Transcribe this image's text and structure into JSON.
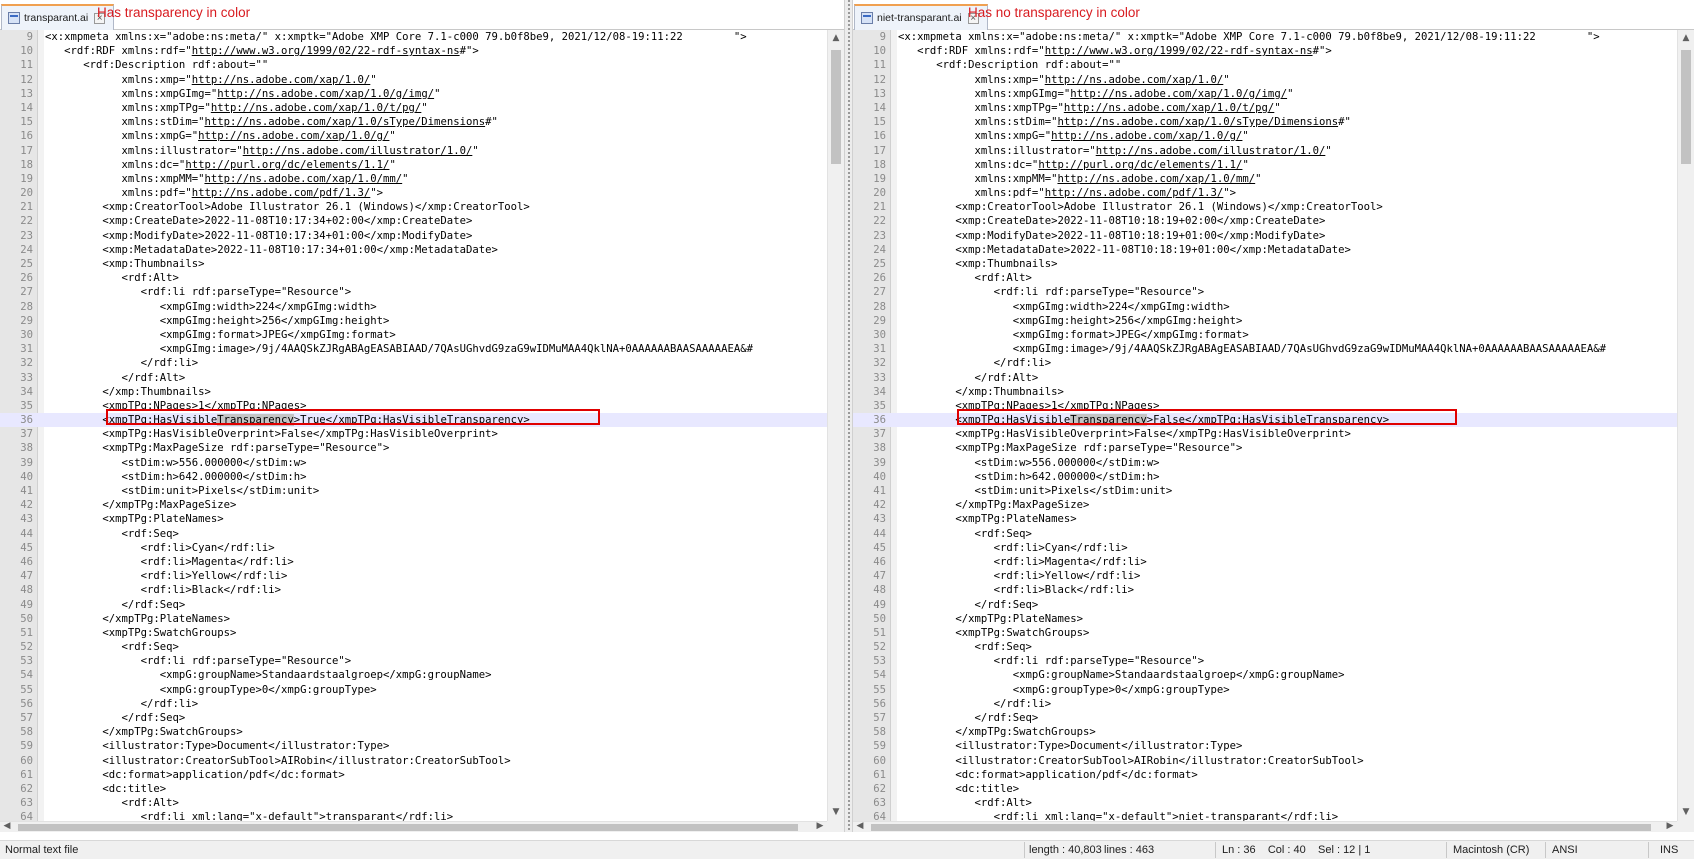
{
  "left": {
    "tab": {
      "label": "transparant.ai",
      "close": "×"
    },
    "note": "Has transparency in color",
    "lines": [
      {
        "n": "9",
        "s": [
          [
            "<x:xmpmeta xmlns:x=\"adobe:ns:meta/\" x:xmptk=\"Adobe XMP Core 7.1-c000 79.b0f8be9, 2021/12/08-19:11:22        \">"
          ]
        ]
      },
      {
        "n": "10",
        "s": [
          [
            "   <rdf:RDF xmlns:rdf=\""
          ],
          [
            "http://www.w3.org/1999/02/22-rdf-syntax-ns",
            "u"
          ],
          [
            "#\">"
          ]
        ]
      },
      {
        "n": "11",
        "s": [
          [
            "      <rdf:Description rdf:about=\"\""
          ]
        ]
      },
      {
        "n": "12",
        "s": [
          [
            "            xmlns:xmp=\""
          ],
          [
            "http://ns.adobe.com/xap/1.0/",
            "u"
          ],
          [
            "\""
          ]
        ]
      },
      {
        "n": "13",
        "s": [
          [
            "            xmlns:xmpGImg=\""
          ],
          [
            "http://ns.adobe.com/xap/1.0/g/img/",
            "u"
          ],
          [
            "\""
          ]
        ]
      },
      {
        "n": "14",
        "s": [
          [
            "            xmlns:xmpTPg=\""
          ],
          [
            "http://ns.adobe.com/xap/1.0/t/pg/",
            "u"
          ],
          [
            "\""
          ]
        ]
      },
      {
        "n": "15",
        "s": [
          [
            "            xmlns:stDim=\""
          ],
          [
            "http://ns.adobe.com/xap/1.0/sType/Dimensions",
            "u"
          ],
          [
            "#\""
          ]
        ]
      },
      {
        "n": "16",
        "s": [
          [
            "            xmlns:xmpG=\""
          ],
          [
            "http://ns.adobe.com/xap/1.0/g/",
            "u"
          ],
          [
            "\""
          ]
        ]
      },
      {
        "n": "17",
        "s": [
          [
            "            xmlns:illustrator=\""
          ],
          [
            "http://ns.adobe.com/illustrator/1.0/",
            "u"
          ],
          [
            "\""
          ]
        ]
      },
      {
        "n": "18",
        "s": [
          [
            "            xmlns:dc=\""
          ],
          [
            "http://purl.org/dc/elements/1.1/",
            "u"
          ],
          [
            "\""
          ]
        ]
      },
      {
        "n": "19",
        "s": [
          [
            "            xmlns:xmpMM=\""
          ],
          [
            "http://ns.adobe.com/xap/1.0/mm/",
            "u"
          ],
          [
            "\""
          ]
        ]
      },
      {
        "n": "20",
        "s": [
          [
            "            xmlns:pdf=\""
          ],
          [
            "http://ns.adobe.com/pdf/1.3/",
            "u"
          ],
          [
            "\">"
          ]
        ]
      },
      {
        "n": "21",
        "s": [
          [
            "         <xmp:CreatorTool>Adobe Illustrator 26.1 (Windows)</xmp:CreatorTool>"
          ]
        ]
      },
      {
        "n": "22",
        "s": [
          [
            "         <xmp:CreateDate>2022-11-08T10:17:34+02:00</xmp:CreateDate>"
          ]
        ]
      },
      {
        "n": "23",
        "s": [
          [
            "         <xmp:ModifyDate>2022-11-08T10:17:34+01:00</xmp:ModifyDate>"
          ]
        ]
      },
      {
        "n": "24",
        "s": [
          [
            "         <xmp:MetadataDate>2022-11-08T10:17:34+01:00</xmp:MetadataDate>"
          ]
        ]
      },
      {
        "n": "25",
        "s": [
          [
            "         <xmp:Thumbnails>"
          ]
        ]
      },
      {
        "n": "26",
        "s": [
          [
            "            <rdf:Alt>"
          ]
        ]
      },
      {
        "n": "27",
        "s": [
          [
            "               <rdf:li rdf:parseType=\"Resource\">"
          ]
        ]
      },
      {
        "n": "28",
        "s": [
          [
            "                  <xmpGImg:width>224</xmpGImg:width>"
          ]
        ]
      },
      {
        "n": "29",
        "s": [
          [
            "                  <xmpGImg:height>256</xmpGImg:height>"
          ]
        ]
      },
      {
        "n": "30",
        "s": [
          [
            "                  <xmpGImg:format>JPEG</xmpGImg:format>"
          ]
        ]
      },
      {
        "n": "31",
        "s": [
          [
            "                  <xmpGImg:image>/9j/4AAQSkZJRgABAgEASABIAAD/7QAsUGhvdG9zaG9wIDMuMAA4QklNA+0AAAAAABAASAAAAAEA&#"
          ]
        ]
      },
      {
        "n": "32",
        "s": [
          [
            "               </rdf:li>"
          ]
        ]
      },
      {
        "n": "33",
        "s": [
          [
            "            </rdf:Alt>"
          ]
        ]
      },
      {
        "n": "34",
        "s": [
          [
            "         </xmp:Thumbnails>"
          ]
        ]
      },
      {
        "n": "35",
        "s": [
          [
            "         <xmpTPg:NPages>1</xmpTPg:NPages>"
          ]
        ]
      },
      {
        "n": "36",
        "cur": true,
        "s": [
          [
            "         <xmpTPg:HasVisible"
          ],
          [
            "Transparency",
            "hl"
          ],
          [
            ">True</xmpTPg:HasVisibleTransparency>"
          ]
        ]
      },
      {
        "n": "37",
        "s": [
          [
            "         <xmpTPg:HasVisibleOverprint>False</xmpTPg:HasVisibleOverprint>"
          ]
        ]
      },
      {
        "n": "38",
        "s": [
          [
            "         <xmpTPg:MaxPageSize rdf:parseType=\"Resource\">"
          ]
        ]
      },
      {
        "n": "39",
        "s": [
          [
            "            <stDim:w>556.000000</stDim:w>"
          ]
        ]
      },
      {
        "n": "40",
        "s": [
          [
            "            <stDim:h>642.000000</stDim:h>"
          ]
        ]
      },
      {
        "n": "41",
        "s": [
          [
            "            <stDim:unit>Pixels</stDim:unit>"
          ]
        ]
      },
      {
        "n": "42",
        "s": [
          [
            "         </xmpTPg:MaxPageSize>"
          ]
        ]
      },
      {
        "n": "43",
        "s": [
          [
            "         <xmpTPg:PlateNames>"
          ]
        ]
      },
      {
        "n": "44",
        "s": [
          [
            "            <rdf:Seq>"
          ]
        ]
      },
      {
        "n": "45",
        "s": [
          [
            "               <rdf:li>Cyan</rdf:li>"
          ]
        ]
      },
      {
        "n": "46",
        "s": [
          [
            "               <rdf:li>Magenta</rdf:li>"
          ]
        ]
      },
      {
        "n": "47",
        "s": [
          [
            "               <rdf:li>Yellow</rdf:li>"
          ]
        ]
      },
      {
        "n": "48",
        "s": [
          [
            "               <rdf:li>Black</rdf:li>"
          ]
        ]
      },
      {
        "n": "49",
        "s": [
          [
            "            </rdf:Seq>"
          ]
        ]
      },
      {
        "n": "50",
        "s": [
          [
            "         </xmpTPg:PlateNames>"
          ]
        ]
      },
      {
        "n": "51",
        "s": [
          [
            "         <xmpTPg:SwatchGroups>"
          ]
        ]
      },
      {
        "n": "52",
        "s": [
          [
            "            <rdf:Seq>"
          ]
        ]
      },
      {
        "n": "53",
        "s": [
          [
            "               <rdf:li rdf:parseType=\"Resource\">"
          ]
        ]
      },
      {
        "n": "54",
        "s": [
          [
            "                  <xmpG:groupName>Standaardstaalgroep</xmpG:groupName>"
          ]
        ]
      },
      {
        "n": "55",
        "s": [
          [
            "                  <xmpG:groupType>0</xmpG:groupType>"
          ]
        ]
      },
      {
        "n": "56",
        "s": [
          [
            "               </rdf:li>"
          ]
        ]
      },
      {
        "n": "57",
        "s": [
          [
            "            </rdf:Seq>"
          ]
        ]
      },
      {
        "n": "58",
        "s": [
          [
            "         </xmpTPg:SwatchGroups>"
          ]
        ]
      },
      {
        "n": "59",
        "s": [
          [
            "         <illustrator:Type>Document</illustrator:Type>"
          ]
        ]
      },
      {
        "n": "60",
        "s": [
          [
            "         <illustrator:CreatorSubTool>AIRobin</illustrator:CreatorSubTool>"
          ]
        ]
      },
      {
        "n": "61",
        "s": [
          [
            "         <dc:format>application/pdf</dc:format>"
          ]
        ]
      },
      {
        "n": "62",
        "s": [
          [
            "         <dc:title>"
          ]
        ]
      },
      {
        "n": "63",
        "s": [
          [
            "            <rdf:Alt>"
          ]
        ]
      },
      {
        "n": "64",
        "s": [
          [
            "               <rdf:li xml:lang=\"x-default\">transparant</rdf:li>"
          ]
        ]
      }
    ]
  },
  "right": {
    "tab": {
      "label": "niet-transparant.ai",
      "close": "×"
    },
    "note": "Has no transparency in color",
    "lines": [
      {
        "n": "9",
        "s": [
          [
            "<x:xmpmeta xmlns:x=\"adobe:ns:meta/\" x:xmptk=\"Adobe XMP Core 7.1-c000 79.b0f8be9, 2021/12/08-19:11:22        \">"
          ]
        ]
      },
      {
        "n": "10",
        "s": [
          [
            "   <rdf:RDF xmlns:rdf=\""
          ],
          [
            "http://www.w3.org/1999/02/22-rdf-syntax-ns",
            "u"
          ],
          [
            "#\">"
          ]
        ]
      },
      {
        "n": "11",
        "s": [
          [
            "      <rdf:Description rdf:about=\"\""
          ]
        ]
      },
      {
        "n": "12",
        "s": [
          [
            "            xmlns:xmp=\""
          ],
          [
            "http://ns.adobe.com/xap/1.0/",
            "u"
          ],
          [
            "\""
          ]
        ]
      },
      {
        "n": "13",
        "s": [
          [
            "            xmlns:xmpGImg=\""
          ],
          [
            "http://ns.adobe.com/xap/1.0/g/img/",
            "u"
          ],
          [
            "\""
          ]
        ]
      },
      {
        "n": "14",
        "s": [
          [
            "            xmlns:xmpTPg=\""
          ],
          [
            "http://ns.adobe.com/xap/1.0/t/pg/",
            "u"
          ],
          [
            "\""
          ]
        ]
      },
      {
        "n": "15",
        "s": [
          [
            "            xmlns:stDim=\""
          ],
          [
            "http://ns.adobe.com/xap/1.0/sType/Dimensions",
            "u"
          ],
          [
            "#\""
          ]
        ]
      },
      {
        "n": "16",
        "s": [
          [
            "            xmlns:xmpG=\""
          ],
          [
            "http://ns.adobe.com/xap/1.0/g/",
            "u"
          ],
          [
            "\""
          ]
        ]
      },
      {
        "n": "17",
        "s": [
          [
            "            xmlns:illustrator=\""
          ],
          [
            "http://ns.adobe.com/illustrator/1.0/",
            "u"
          ],
          [
            "\""
          ]
        ]
      },
      {
        "n": "18",
        "s": [
          [
            "            xmlns:dc=\""
          ],
          [
            "http://purl.org/dc/elements/1.1/",
            "u"
          ],
          [
            "\""
          ]
        ]
      },
      {
        "n": "19",
        "s": [
          [
            "            xmlns:xmpMM=\""
          ],
          [
            "http://ns.adobe.com/xap/1.0/mm/",
            "u"
          ],
          [
            "\""
          ]
        ]
      },
      {
        "n": "20",
        "s": [
          [
            "            xmlns:pdf=\""
          ],
          [
            "http://ns.adobe.com/pdf/1.3/",
            "u"
          ],
          [
            "\">"
          ]
        ]
      },
      {
        "n": "21",
        "s": [
          [
            "         <xmp:CreatorTool>Adobe Illustrator 26.1 (Windows)</xmp:CreatorTool>"
          ]
        ]
      },
      {
        "n": "22",
        "s": [
          [
            "         <xmp:CreateDate>2022-11-08T10:18:19+02:00</xmp:CreateDate>"
          ]
        ]
      },
      {
        "n": "23",
        "s": [
          [
            "         <xmp:ModifyDate>2022-11-08T10:18:19+01:00</xmp:ModifyDate>"
          ]
        ]
      },
      {
        "n": "24",
        "s": [
          [
            "         <xmp:MetadataDate>2022-11-08T10:18:19+01:00</xmp:MetadataDate>"
          ]
        ]
      },
      {
        "n": "25",
        "s": [
          [
            "         <xmp:Thumbnails>"
          ]
        ]
      },
      {
        "n": "26",
        "s": [
          [
            "            <rdf:Alt>"
          ]
        ]
      },
      {
        "n": "27",
        "s": [
          [
            "               <rdf:li rdf:parseType=\"Resource\">"
          ]
        ]
      },
      {
        "n": "28",
        "s": [
          [
            "                  <xmpGImg:width>224</xmpGImg:width>"
          ]
        ]
      },
      {
        "n": "29",
        "s": [
          [
            "                  <xmpGImg:height>256</xmpGImg:height>"
          ]
        ]
      },
      {
        "n": "30",
        "s": [
          [
            "                  <xmpGImg:format>JPEG</xmpGImg:format>"
          ]
        ]
      },
      {
        "n": "31",
        "s": [
          [
            "                  <xmpGImg:image>/9j/4AAQSkZJRgABAgEASABIAAD/7QAsUGhvdG9zaG9wIDMuMAA4QklNA+0AAAAAABAASAAAAAEA&#"
          ]
        ]
      },
      {
        "n": "32",
        "s": [
          [
            "               </rdf:li>"
          ]
        ]
      },
      {
        "n": "33",
        "s": [
          [
            "            </rdf:Alt>"
          ]
        ]
      },
      {
        "n": "34",
        "s": [
          [
            "         </xmp:Thumbnails>"
          ]
        ]
      },
      {
        "n": "35",
        "s": [
          [
            "         <xmpTPg:NPages>1</xmpTPg:NPages>"
          ]
        ]
      },
      {
        "n": "36",
        "cur": true,
        "s": [
          [
            "         <xmpTPg:HasVisible"
          ],
          [
            "Transparency",
            "hl"
          ],
          [
            ">False</xmpTPg:HasVisibleTransparency>"
          ]
        ]
      },
      {
        "n": "37",
        "s": [
          [
            "         <xmpTPg:HasVisibleOverprint>False</xmpTPg:HasVisibleOverprint>"
          ]
        ]
      },
      {
        "n": "38",
        "s": [
          [
            "         <xmpTPg:MaxPageSize rdf:parseType=\"Resource\">"
          ]
        ]
      },
      {
        "n": "39",
        "s": [
          [
            "            <stDim:w>556.000000</stDim:w>"
          ]
        ]
      },
      {
        "n": "40",
        "s": [
          [
            "            <stDim:h>642.000000</stDim:h>"
          ]
        ]
      },
      {
        "n": "41",
        "s": [
          [
            "            <stDim:unit>Pixels</stDim:unit>"
          ]
        ]
      },
      {
        "n": "42",
        "s": [
          [
            "         </xmpTPg:MaxPageSize>"
          ]
        ]
      },
      {
        "n": "43",
        "s": [
          [
            "         <xmpTPg:PlateNames>"
          ]
        ]
      },
      {
        "n": "44",
        "s": [
          [
            "            <rdf:Seq>"
          ]
        ]
      },
      {
        "n": "45",
        "s": [
          [
            "               <rdf:li>Cyan</rdf:li>"
          ]
        ]
      },
      {
        "n": "46",
        "s": [
          [
            "               <rdf:li>Magenta</rdf:li>"
          ]
        ]
      },
      {
        "n": "47",
        "s": [
          [
            "               <rdf:li>Yellow</rdf:li>"
          ]
        ]
      },
      {
        "n": "48",
        "s": [
          [
            "               <rdf:li>Black</rdf:li>"
          ]
        ]
      },
      {
        "n": "49",
        "s": [
          [
            "            </rdf:Seq>"
          ]
        ]
      },
      {
        "n": "50",
        "s": [
          [
            "         </xmpTPg:PlateNames>"
          ]
        ]
      },
      {
        "n": "51",
        "s": [
          [
            "         <xmpTPg:SwatchGroups>"
          ]
        ]
      },
      {
        "n": "52",
        "s": [
          [
            "            <rdf:Seq>"
          ]
        ]
      },
      {
        "n": "53",
        "s": [
          [
            "               <rdf:li rdf:parseType=\"Resource\">"
          ]
        ]
      },
      {
        "n": "54",
        "s": [
          [
            "                  <xmpG:groupName>Standaardstaalgroep</xmpG:groupName>"
          ]
        ]
      },
      {
        "n": "55",
        "s": [
          [
            "                  <xmpG:groupType>0</xmpG:groupType>"
          ]
        ]
      },
      {
        "n": "56",
        "s": [
          [
            "               </rdf:li>"
          ]
        ]
      },
      {
        "n": "57",
        "s": [
          [
            "            </rdf:Seq>"
          ]
        ]
      },
      {
        "n": "58",
        "s": [
          [
            "         </xmpTPg:SwatchGroups>"
          ]
        ]
      },
      {
        "n": "59",
        "s": [
          [
            "         <illustrator:Type>Document</illustrator:Type>"
          ]
        ]
      },
      {
        "n": "60",
        "s": [
          [
            "         <illustrator:CreatorSubTool>AIRobin</illustrator:CreatorSubTool>"
          ]
        ]
      },
      {
        "n": "61",
        "s": [
          [
            "         <dc:format>application/pdf</dc:format>"
          ]
        ]
      },
      {
        "n": "62",
        "s": [
          [
            "         <dc:title>"
          ]
        ]
      },
      {
        "n": "63",
        "s": [
          [
            "            <rdf:Alt>"
          ]
        ]
      },
      {
        "n": "64",
        "s": [
          [
            "               <rdf:li xml:lang=\"x-default\">niet-transparant</rdf:li>"
          ]
        ]
      }
    ]
  },
  "scroll": {
    "up": "▲",
    "down": "▼",
    "left": "◀",
    "right": "▶"
  },
  "status": {
    "file_type": "Normal text file",
    "length": "length : 40,803",
    "lines": "lines : 463",
    "position": "Ln : 36    Col : 40    Sel : 12 | 1",
    "eol": "Macintosh (CR)",
    "encoding": "ANSI",
    "mode": "INS"
  },
  "colors": {
    "annotation": "#d81b20",
    "highlight_box": "#e00000",
    "current_line": "#e8e8ff"
  },
  "icons": {
    "tab": "file-icon",
    "close": "close-icon"
  }
}
